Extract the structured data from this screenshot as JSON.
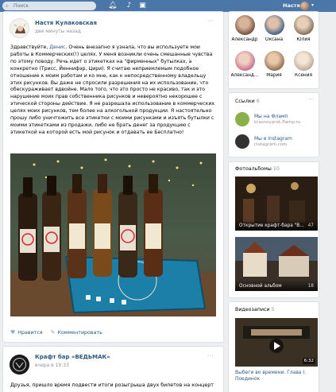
{
  "topbar": {
    "search_placeholder": "Поиск",
    "user_name": "Настя",
    "brand_color": "#4a76a8"
  },
  "post1": {
    "author": "Настя Кулаковская",
    "time": "две минуты назад",
    "text_before_link": "Здравствуйте, ",
    "link": "Денис",
    "text_after_link": ". Очень внезапно я узнала, что вы используете мои работы в Коммерческих(!) целях. У меня возникли очень смешанные чувства по этому поводу. Речь идет о этикетках на \"фирменных\" бутылках, а конкретно (Трисс, Йеннифэр, Цири). Я считаю неприемлемым подобное отношение к моим работам и ко мне, как к непосредственному владельцу этих рисунков. Вы даже не спросили разрешения на их использование, что обескураживает вдвойне. Мало того, что это просто не красиво, так и это нарушение моих прав собственника рисунков и невероятно некорошее с этической стороны действие. Я не разрешала использование в коммерческих целях моих рисунков, тем более на алкогольной продукции. Я настоятельно прошу либо уничтожить все этикетки с моими рисунками и изъять бутылки с моими этикетками из продажи, либо не брать денег за продукцию с этикеткой на которой есть мой рисунок и отдавать ее Бесплатно!",
    "like_label": "Нравится",
    "comment_label": "Комментировать"
  },
  "post2": {
    "author": "Крафт бар «ВЕДЬМАК»",
    "time": "вчера в 19:33",
    "text": "Друзья, пришло время подвести итоги розыгрыша двух билетов на концерт"
  },
  "friends": [
    {
      "name": "Александр",
      "color": "#6b4a3a"
    },
    {
      "name": "Оксана",
      "color": "#3a5a8a"
    },
    {
      "name": "Юлия",
      "color": "#7a6a5a"
    },
    {
      "name": "Александ...",
      "color": "#c86a8a"
    },
    {
      "name": "Мария",
      "color": "#8a6a4a"
    },
    {
      "name": "Ксения",
      "color": "#b8a898"
    }
  ],
  "links": {
    "header": "Ссылки",
    "count": "6",
    "items": [
      {
        "title": "Мы на Фламп",
        "url": "krasnoyarsk.flamp.ru"
      },
      {
        "title": "Мы в Instagram",
        "url": "instagram.com"
      }
    ]
  },
  "albums": {
    "header": "Фотоальбомы",
    "count": "10",
    "items": [
      {
        "title": "Открытие крафт-бара \"В...",
        "count": "47"
      },
      {
        "title": "Основной альбом",
        "count": "18"
      }
    ]
  },
  "videos": {
    "header": "Видеозаписи",
    "count": "5",
    "item": {
      "title": "Выбеги во времени. Глава I. Поединок",
      "duration": "6:32"
    }
  }
}
